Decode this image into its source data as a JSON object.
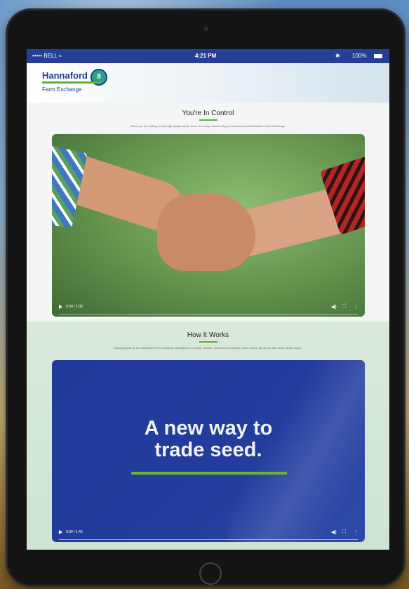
{
  "statusbar": {
    "carrier": "••••• BELL ≈",
    "time": "4:21 PM",
    "bluetooth": "✱",
    "battery": "100%"
  },
  "header": {
    "logo_title": "Hannaford",
    "logo_badge": "8",
    "logo_subtitle": "Farm Exchange"
  },
  "section1": {
    "title": "You're In Control",
    "description": "When you are looking to buy high-quality seeds, there are many reasons why you should choose Hannaford Farm Exchange."
  },
  "video1": {
    "time": "0:00 / 1:08",
    "volume_icon": "speaker-icon",
    "fullscreen_icon": "fullscreen-icon",
    "menu_icon": "more-vert-icon"
  },
  "section2": {
    "title": "How It Works",
    "description": "Buying seeds on 8X Hannaford Farm Exchange marketplace is simple, reliable, convenient and quick. Learn how to get set up with these simple steps."
  },
  "video2": {
    "headline_line1": "A new way to",
    "headline_line2": "trade seed.",
    "time": "0:00 / 1:42"
  },
  "colors": {
    "brand_blue": "#1f3d91",
    "brand_green": "#5eb234",
    "status_bar": "#243f93"
  }
}
